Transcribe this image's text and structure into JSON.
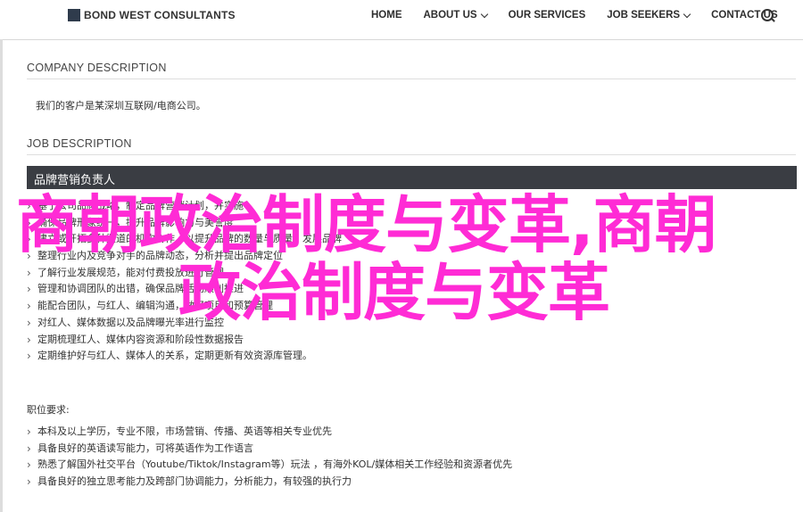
{
  "header": {
    "logo_text": "BOND WEST CONSULTANTS",
    "nav": [
      {
        "label": "HOME",
        "has_dropdown": false
      },
      {
        "label": "ABOUT US",
        "has_dropdown": true
      },
      {
        "label": "OUR SERVICES",
        "has_dropdown": false
      },
      {
        "label": "JOB SEEKERS",
        "has_dropdown": true
      },
      {
        "label": "CONTACT US",
        "has_dropdown": false
      }
    ],
    "search_icon": "search-icon"
  },
  "company": {
    "title": "COMPANY DESCRIPTION",
    "text": "我们的客户是某深圳互联网/电商公司。"
  },
  "job": {
    "title": "JOB DESCRIPTION",
    "position": "品牌营销负责人",
    "duties": [
      "基于公司品牌战略，制定品牌营销计划，并实施",
      "确保品牌形象统一，提升品牌影响力与美誉度",
      "建立或开拓多种渠道的机构合作，以提升品牌的数量与质量，发展品牌",
      "整理行业内及竞争对手的品牌动态，分析并提出品牌定位",
      "了解行业发展规范，能对付费投放进行管理",
      "管理和协调团队的出错，确保品牌活动顺利推进",
      "能配合团队，与红人、编辑沟通，做好项目和预算管理",
      "对红人、媒体数据以及品牌曝光率进行监控",
      "定期梳理红人、媒体内容资源和阶段性数据报告",
      "定期维护好与红人、媒体人的关系，定期更新有效资源库管理。"
    ],
    "requirements_title": "职位要求:",
    "requirements": [
      "本科及以上学历，专业不限，市场营销、传播、英语等相关专业优先",
      "具备良好的英语读写能力，可将英语作为工作语言",
      "熟悉了解国外社交平台（Youtube/Tiktok/Instagram等）玩法 ，有海外KOL/媒体相关工作经验和资源者优先",
      "具备良好的独立思考能力及跨部门协调能力，分析能力，有较强的执行力"
    ]
  },
  "overlay": {
    "line1": "商朝政治制度与变革,商朝",
    "line2": "政治制度与变革",
    "color": "#ff2bd5"
  }
}
